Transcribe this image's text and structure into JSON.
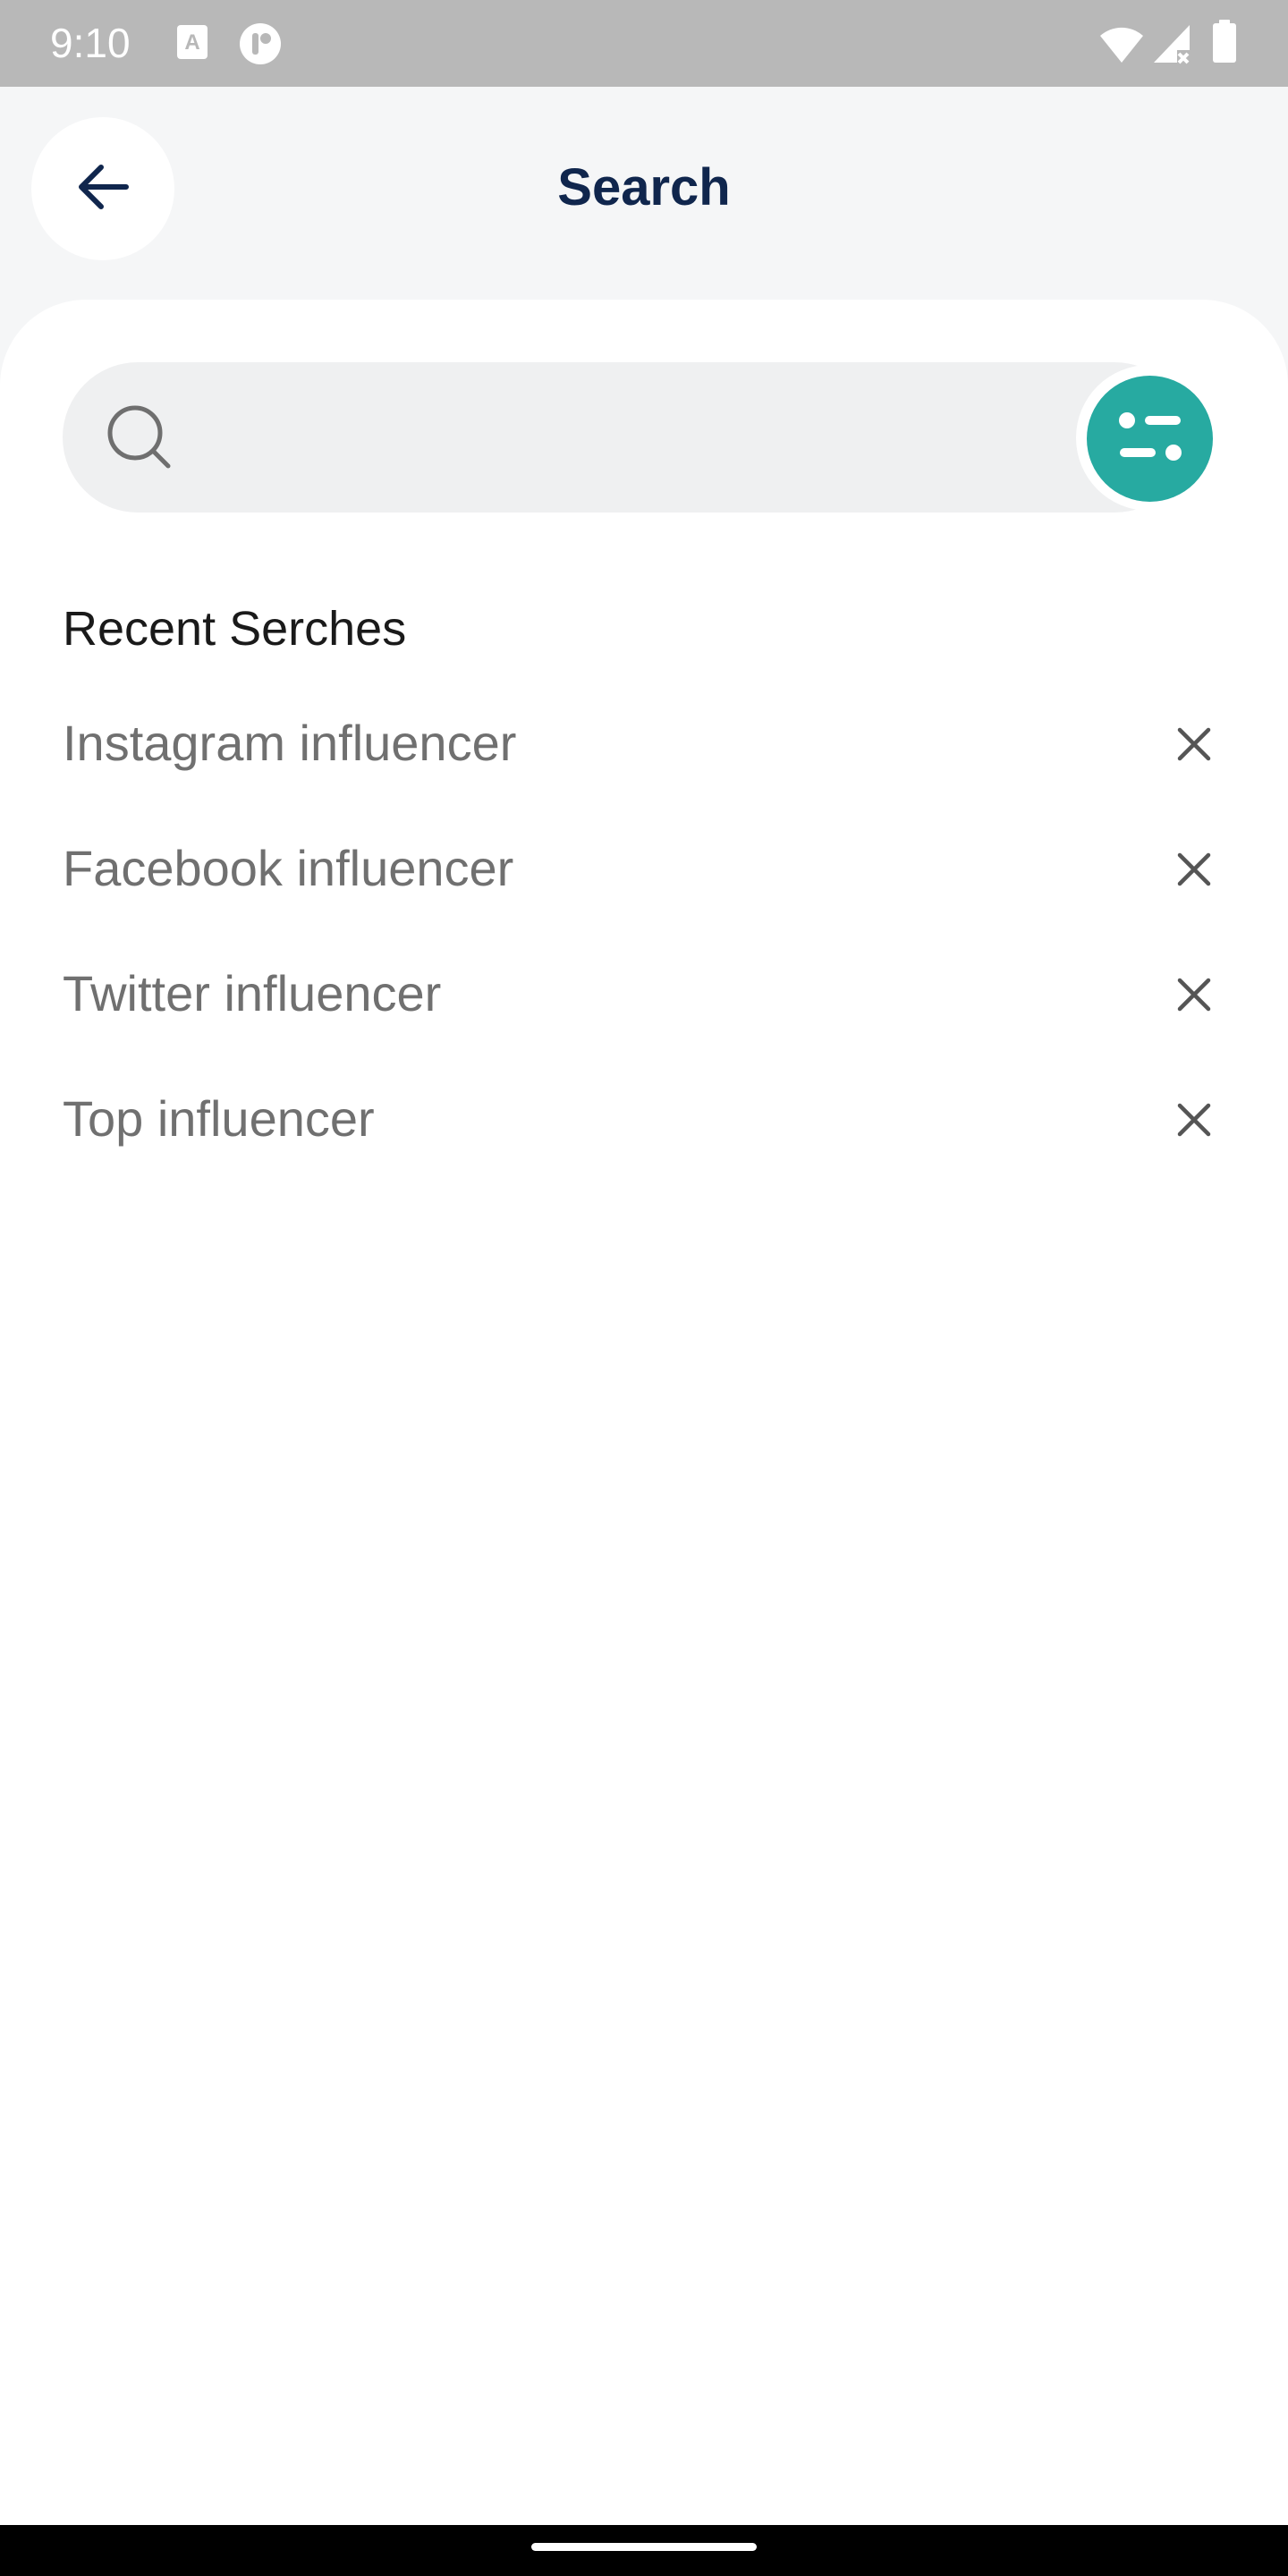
{
  "status_bar": {
    "time": "9:10",
    "icons": [
      "accessibility-a-icon",
      "notification-app-icon",
      "wifi-icon",
      "signal-no-data-icon",
      "battery-icon"
    ]
  },
  "header": {
    "title": "Search",
    "back_icon": "arrow-left-icon"
  },
  "search": {
    "value": "",
    "placeholder": "",
    "search_icon": "search-icon",
    "filter_icon": "filter-sliders-icon"
  },
  "recent": {
    "heading": "Recent Serches",
    "items": [
      {
        "label": "Instagram influencer"
      },
      {
        "label": "Facebook influencer"
      },
      {
        "label": "Twitter influencer"
      },
      {
        "label": "Top influencer"
      }
    ],
    "remove_icon": "close-icon"
  },
  "colors": {
    "accent": "#27aaa1",
    "title": "#10264d",
    "status_bar": "#b8b8b8",
    "background": "#f5f6f7",
    "search_bg": "#eff0f1",
    "muted_text": "#707070"
  }
}
